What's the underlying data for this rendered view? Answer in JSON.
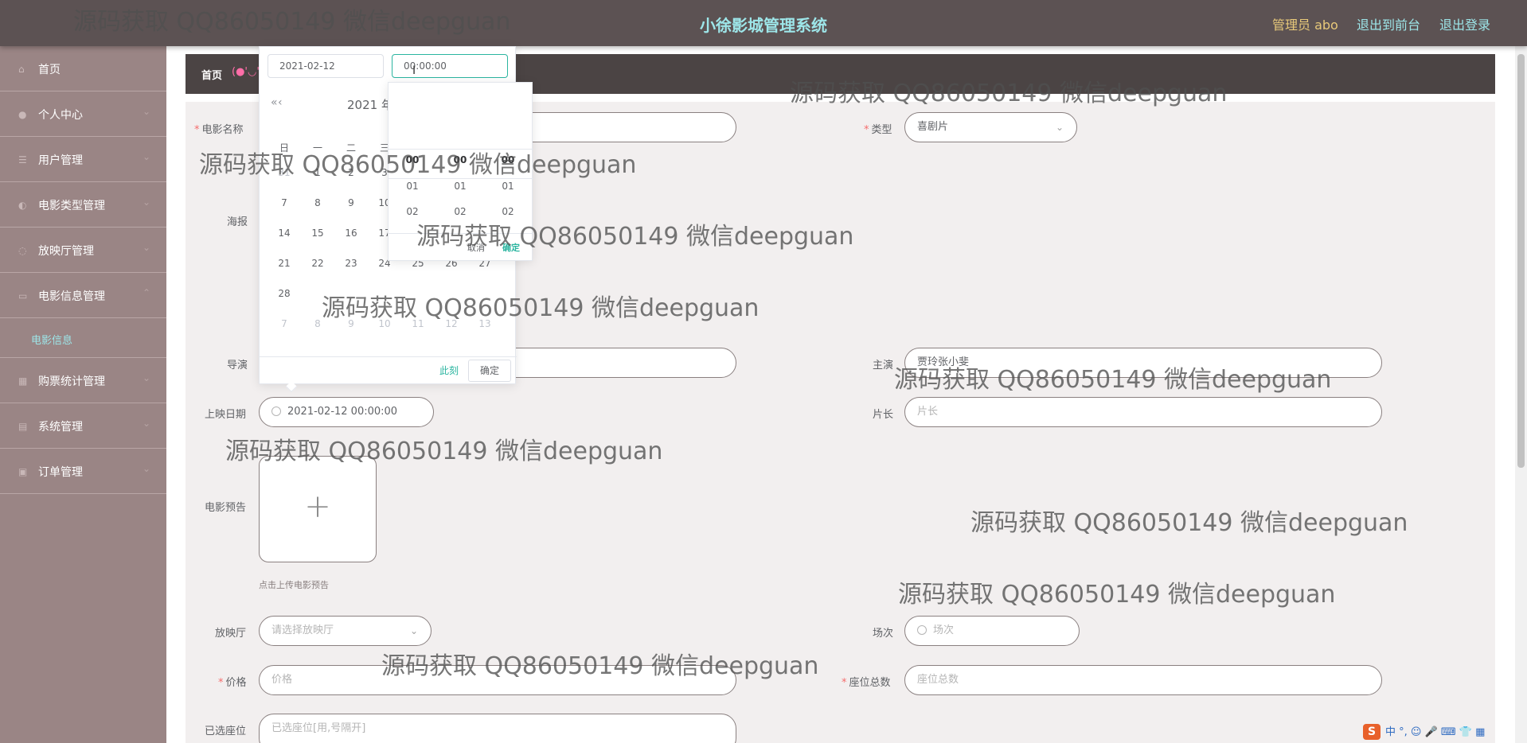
{
  "header": {
    "title": "小徐影城管理系统",
    "admin": "管理员 abo",
    "to_front": "退出到前台",
    "logout": "退出登录"
  },
  "sidebar": {
    "items": [
      {
        "label": "首页",
        "icon": "home-icon"
      },
      {
        "label": "个人中心",
        "icon": "user-icon"
      },
      {
        "label": "用户管理",
        "icon": "list-icon"
      },
      {
        "label": "电影类型管理",
        "icon": "tag-icon"
      },
      {
        "label": "放映厅管理",
        "icon": "screen-icon"
      },
      {
        "label": "电影信息管理",
        "icon": "film-icon"
      },
      {
        "label": "购票统计管理",
        "icon": "chart-icon"
      },
      {
        "label": "系统管理",
        "icon": "settings-icon"
      },
      {
        "label": "订单管理",
        "icon": "order-icon"
      }
    ],
    "submenu_label": "电影信息"
  },
  "breadcrumb": {
    "home": "首页",
    "face": "(●'◡'"
  },
  "form": {
    "movie_name_label": "电影名称",
    "type_label": "类型",
    "type_value": "喜剧片",
    "poster_label": "海报",
    "director_label": "导演",
    "cast_label": "主演",
    "cast_value": "贾玲张小斐",
    "release_label": "上映日期",
    "release_value": "2021-02-12 00:00:00",
    "length_label": "片长",
    "length_placeholder": "片长",
    "trailer_label": "电影预告",
    "trailer_hint": "点击上传电影预告",
    "hall_label": "放映厅",
    "hall_placeholder": "请选择放映厅",
    "session_label": "场次",
    "session_placeholder": "场次",
    "price_label": "价格",
    "price_placeholder": "价格",
    "seats_total_label": "座位总数",
    "seats_total_placeholder": "座位总数",
    "selected_seats_label": "已选座位",
    "selected_seats_placeholder": "已选座位[用,号隔开]"
  },
  "picker": {
    "date_input": "2021-02-12",
    "time_input": "00:00:00",
    "month_label": "2021 年",
    "weekdays": [
      "日",
      "一",
      "二",
      "三"
    ],
    "rows": [
      [
        {
          "d": "31",
          "o": true
        },
        {
          "d": "1"
        },
        {
          "d": "2"
        },
        {
          "d": "3"
        }
      ],
      [
        {
          "d": "7"
        },
        {
          "d": "8"
        },
        {
          "d": "9"
        },
        {
          "d": "10"
        }
      ],
      [
        {
          "d": "14"
        },
        {
          "d": "15"
        },
        {
          "d": "16"
        },
        {
          "d": "17"
        }
      ],
      [
        {
          "d": "21"
        },
        {
          "d": "22"
        },
        {
          "d": "23"
        },
        {
          "d": "24"
        },
        {
          "d": "25"
        },
        {
          "d": "26"
        },
        {
          "d": "27"
        }
      ],
      [
        {
          "d": "28"
        }
      ],
      [
        {
          "d": "7",
          "o": true
        },
        {
          "d": "8",
          "o": true
        },
        {
          "d": "9",
          "o": true
        },
        {
          "d": "10",
          "o": true
        },
        {
          "d": "11",
          "o": true
        },
        {
          "d": "12",
          "o": true
        },
        {
          "d": "13",
          "o": true
        }
      ]
    ],
    "now_label": "此刻",
    "ok_label": "确定"
  },
  "spinner": {
    "hours": [
      "00",
      "01",
      "02"
    ],
    "minutes": [
      "00",
      "01",
      "02"
    ],
    "seconds": [
      "00",
      "01",
      "02"
    ],
    "cancel": "取消",
    "ok": "确定"
  },
  "watermark": "源码获取 QQ86050149 微信deepguan",
  "ime": {
    "logo": "S",
    "text": "中 °, ☺ 🎤 ⌨ 👕 ▦"
  },
  "colors": {
    "header_bg": "#5c5253",
    "sidebar_bg": "#9a8585",
    "accent": "#9de6e9",
    "admin": "#e8c97a",
    "picker_accent": "#2bb5a0"
  }
}
